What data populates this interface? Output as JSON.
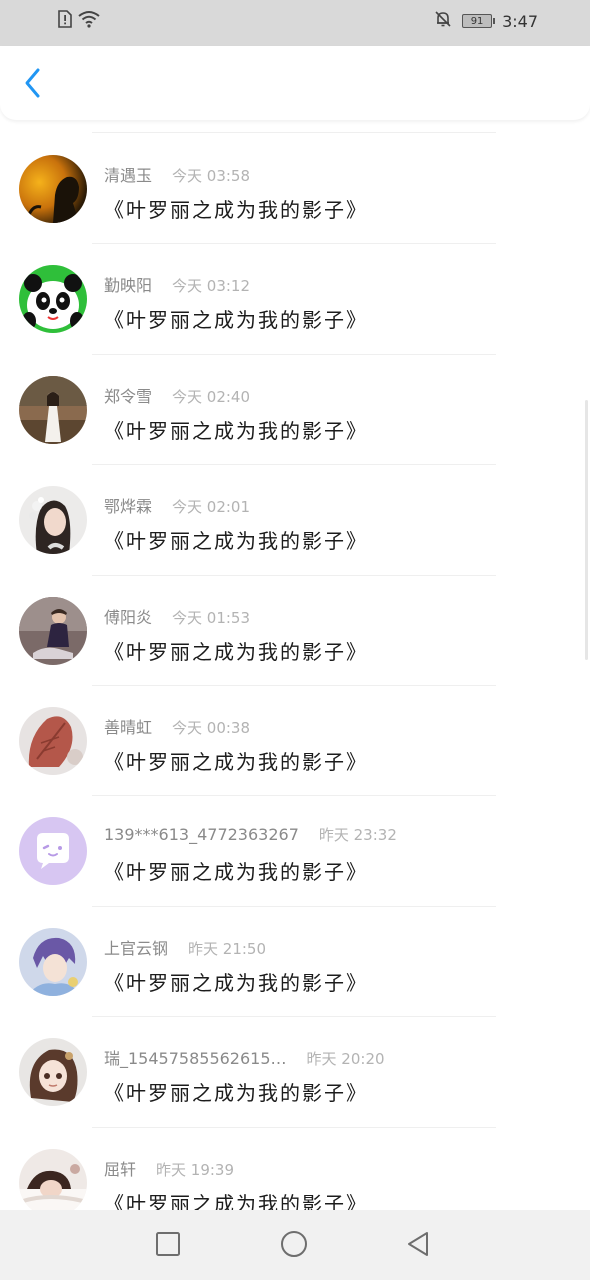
{
  "status_bar": {
    "time": "3:47",
    "battery": "91",
    "icons": [
      "sim-alert-icon",
      "wifi-icon",
      "bell-muted-icon",
      "battery-icon"
    ]
  },
  "header": {
    "back_icon": "chevron-left-icon",
    "accent_color": "#2196f3"
  },
  "messages": [
    {
      "name": "清遇玉",
      "time": "今天 03:58",
      "text": "《叶罗丽之成为我的影子》",
      "avatar": "dark-silhouette"
    },
    {
      "name": "勤映阳",
      "time": "今天 03:12",
      "text": "《叶罗丽之成为我的影子》",
      "avatar": "panda"
    },
    {
      "name": "郑令雪",
      "time": "今天 02:40",
      "text": "《叶罗丽之成为我的影子》",
      "avatar": "girl-white-dress"
    },
    {
      "name": "鄂烨霖",
      "time": "今天 02:01",
      "text": "《叶罗丽之成为我的影子》",
      "avatar": "girl-flowers"
    },
    {
      "name": "傅阳炎",
      "time": "今天 01:53",
      "text": "《叶罗丽之成为我的影子》",
      "avatar": "boy-sitting"
    },
    {
      "name": "善晴虹",
      "time": "今天 00:38",
      "text": "《叶罗丽之成为我的影子》",
      "avatar": "autumn-leaf"
    },
    {
      "name": "139***613_4772363267",
      "time": "昨天 23:32",
      "text": "《叶罗丽之成为我的影子》",
      "avatar": "chat-bubble-default"
    },
    {
      "name": "上官云钢",
      "time": "昨天 21:50",
      "text": "《叶罗丽之成为我的影子》",
      "avatar": "anime-boy"
    },
    {
      "name": "瑞_15457585562615…",
      "time": "昨天 20:20",
      "text": "《叶罗丽之成为我的影子》",
      "avatar": "anime-girl"
    },
    {
      "name": "屈轩",
      "time": "昨天 19:39",
      "text": "《叶罗丽之成为我的影子》",
      "avatar": "girl-lying"
    }
  ],
  "nav": {
    "recents": "square-icon",
    "home": "circle-icon",
    "back": "triangle-back-icon"
  }
}
